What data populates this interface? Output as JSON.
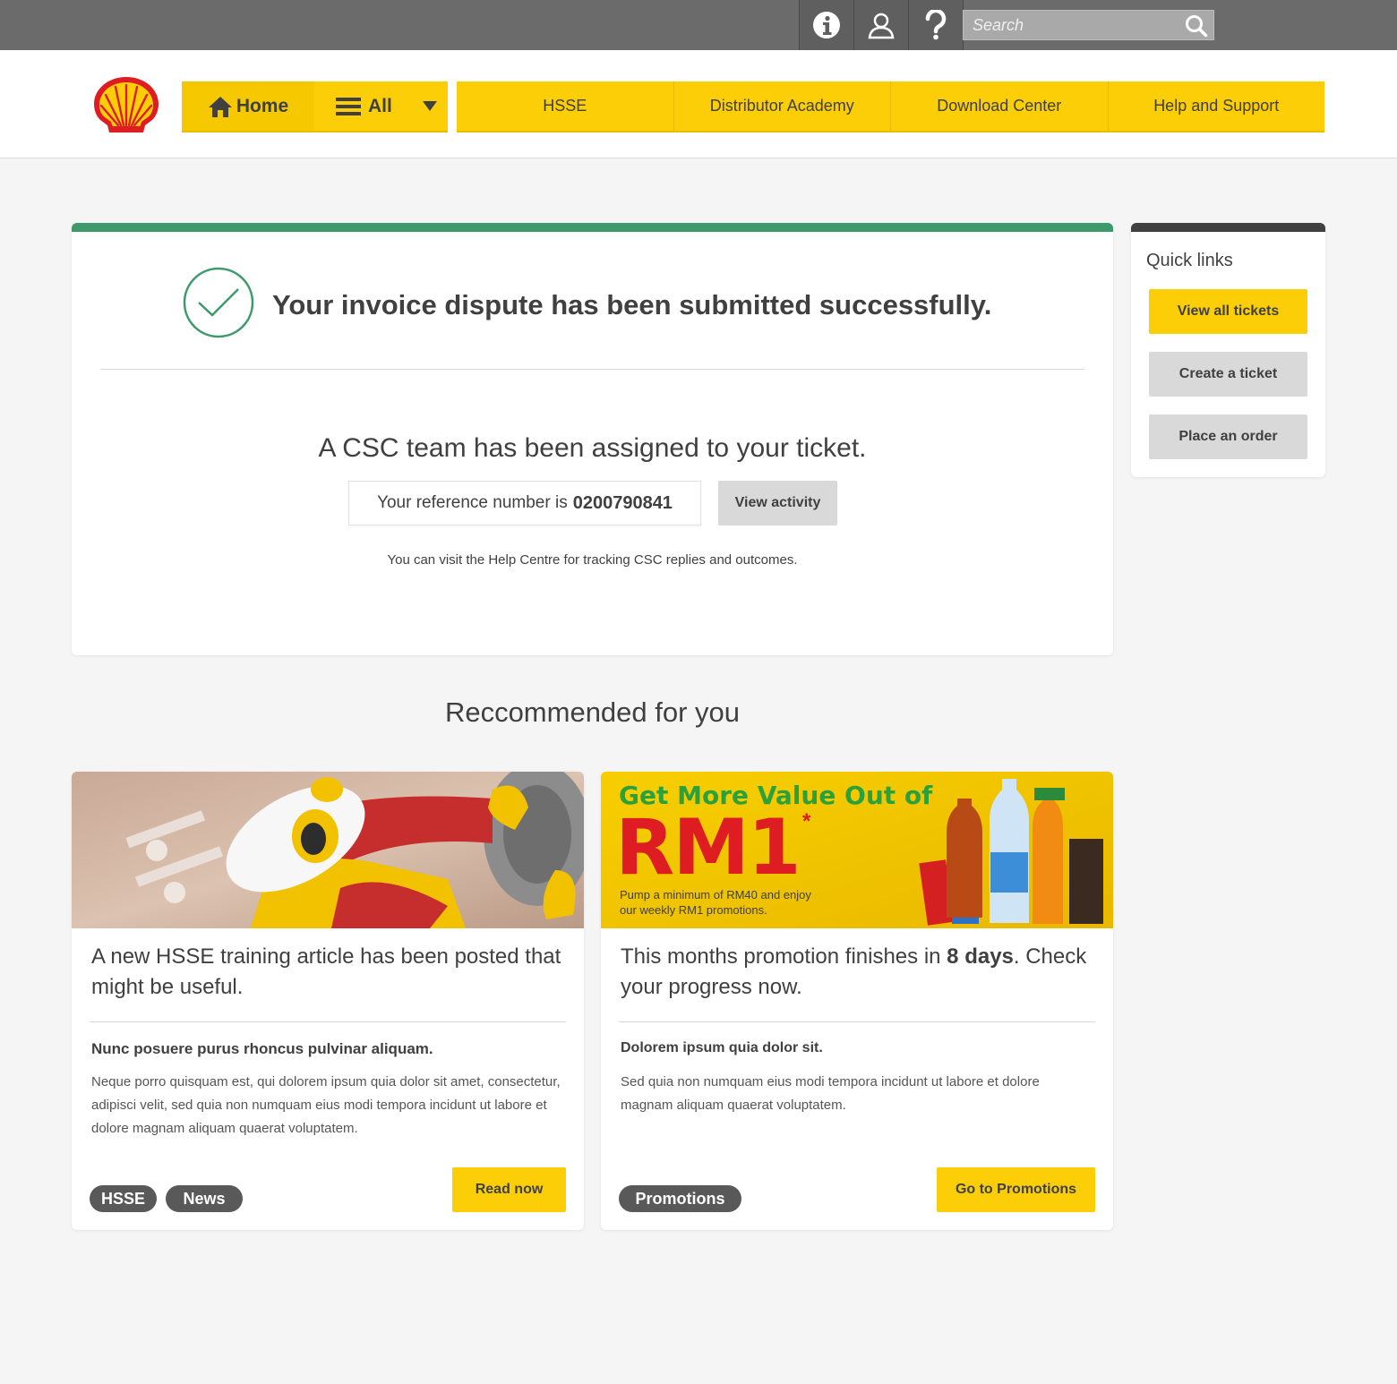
{
  "topbar": {
    "icons": [
      "info-icon",
      "user-icon",
      "help-icon"
    ],
    "search": {
      "placeholder": "Search",
      "value": ""
    }
  },
  "header": {
    "logo": "shell-logo",
    "home_label": "Home",
    "all_label": "All",
    "nav": [
      "HSSE",
      "Distributor Academy",
      "Download Center",
      "Help and Support"
    ]
  },
  "confirmation": {
    "title": "Your invoice dispute has been submitted successfully.",
    "assigned": "A CSC team has been assigned to your ticket.",
    "ref_prefix": "Your reference number is",
    "ref_number": "0200790841",
    "view_activity": "View activity",
    "help_text": "You can visit the Help Centre for tracking CSC replies and outcomes."
  },
  "quick_links": {
    "title": "Quick links",
    "buttons": [
      "View all tickets",
      "Create a ticket",
      "Place an order"
    ]
  },
  "recommended": {
    "title": "Reccommended for you",
    "cards": [
      {
        "heading": "A new HSSE training article has been posted that might be useful.",
        "subheading": "Nunc posuere purus rhoncus pulvinar aliquam.",
        "body": "Neque porro quisquam est, qui dolorem ipsum quia dolor sit amet, consectetur, adipisci velit, sed quia non numquam eius modi tempora incidunt ut labore et dolore magnam aliquam quaerat voluptatem.",
        "tags": [
          "HSSE",
          "News"
        ],
        "cta": "Read now"
      },
      {
        "heading_prefix": "This months promotion finishes in",
        "heading_bold": "8 days",
        "heading_suffix": ". Check your progress now.",
        "subheading": "Dolorem ipsum quia dolor sit.",
        "body": "Sed quia non numquam eius modi tempora incidunt ut labore et dolore magnam aliquam quaerat voluptatem.",
        "tags": [
          "Promotions"
        ],
        "cta": "Go to Promotions",
        "banner": {
          "headline": "Get More Value Out of",
          "big": "RM1",
          "asterisk": "*",
          "line1": "Pump a minimum of RM40 and enjoy",
          "line2": "our weekly RM1 promotions."
        }
      }
    ]
  },
  "colors": {
    "brand_yellow": "#fbce07",
    "success_green": "#3e9a6a",
    "brand_red": "#dd1d21",
    "dark": "#404040"
  }
}
